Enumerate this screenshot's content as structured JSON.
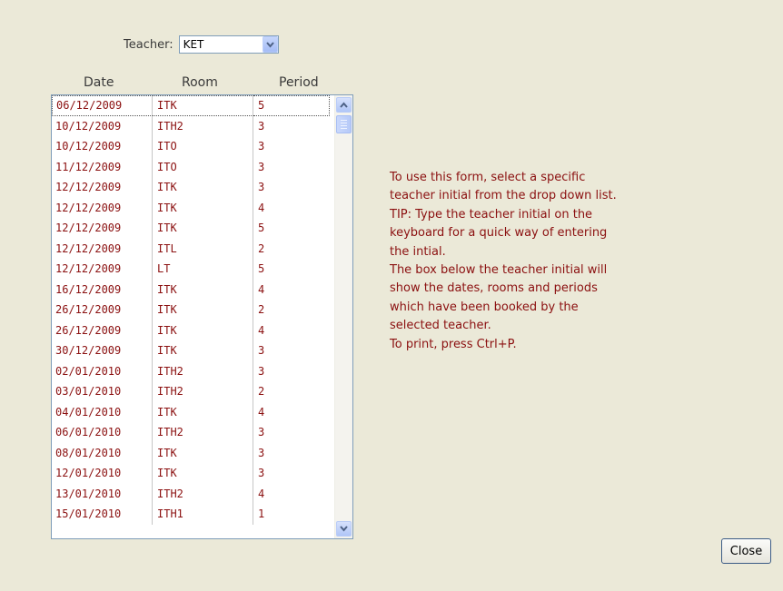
{
  "teacher": {
    "label": "Teacher:",
    "value": "KET"
  },
  "columns": {
    "date": "Date",
    "room": "Room",
    "period": "Period"
  },
  "bookings": [
    {
      "date": "06/12/2009",
      "room": "ITK",
      "period": "5"
    },
    {
      "date": "10/12/2009",
      "room": "ITH2",
      "period": "3"
    },
    {
      "date": "10/12/2009",
      "room": "ITO",
      "period": "3"
    },
    {
      "date": "11/12/2009",
      "room": "ITO",
      "period": "3"
    },
    {
      "date": "12/12/2009",
      "room": "ITK",
      "period": "3"
    },
    {
      "date": "12/12/2009",
      "room": "ITK",
      "period": "4"
    },
    {
      "date": "12/12/2009",
      "room": "ITK",
      "period": "5"
    },
    {
      "date": "12/12/2009",
      "room": "ITL",
      "period": "2"
    },
    {
      "date": "12/12/2009",
      "room": "LT",
      "period": "5"
    },
    {
      "date": "16/12/2009",
      "room": "ITK",
      "period": "4"
    },
    {
      "date": "26/12/2009",
      "room": "ITK",
      "period": "2"
    },
    {
      "date": "26/12/2009",
      "room": "ITK",
      "period": "4"
    },
    {
      "date": "30/12/2009",
      "room": "ITK",
      "period": "3"
    },
    {
      "date": "02/01/2010",
      "room": "ITH2",
      "period": "3"
    },
    {
      "date": "03/01/2010",
      "room": "ITH2",
      "period": "2"
    },
    {
      "date": "04/01/2010",
      "room": "ITK",
      "period": "4"
    },
    {
      "date": "06/01/2010",
      "room": "ITH2",
      "period": "3"
    },
    {
      "date": "08/01/2010",
      "room": "ITK",
      "period": "3"
    },
    {
      "date": "12/01/2010",
      "room": "ITK",
      "period": "3"
    },
    {
      "date": "13/01/2010",
      "room": "ITH2",
      "period": "4"
    },
    {
      "date": "15/01/2010",
      "room": "ITH1",
      "period": "1"
    }
  ],
  "instructions": [
    "To use this form, select a specific",
    "teacher initial from the drop down list.",
    "TIP: Type the teacher initial on the",
    "keyboard for a quick way of entering",
    "the intial.",
    "The box below the teacher initial will",
    "show the dates, rooms and periods",
    "which have been booked by the",
    "selected teacher.",
    "To print, press Ctrl+P."
  ],
  "close_label": "Close"
}
